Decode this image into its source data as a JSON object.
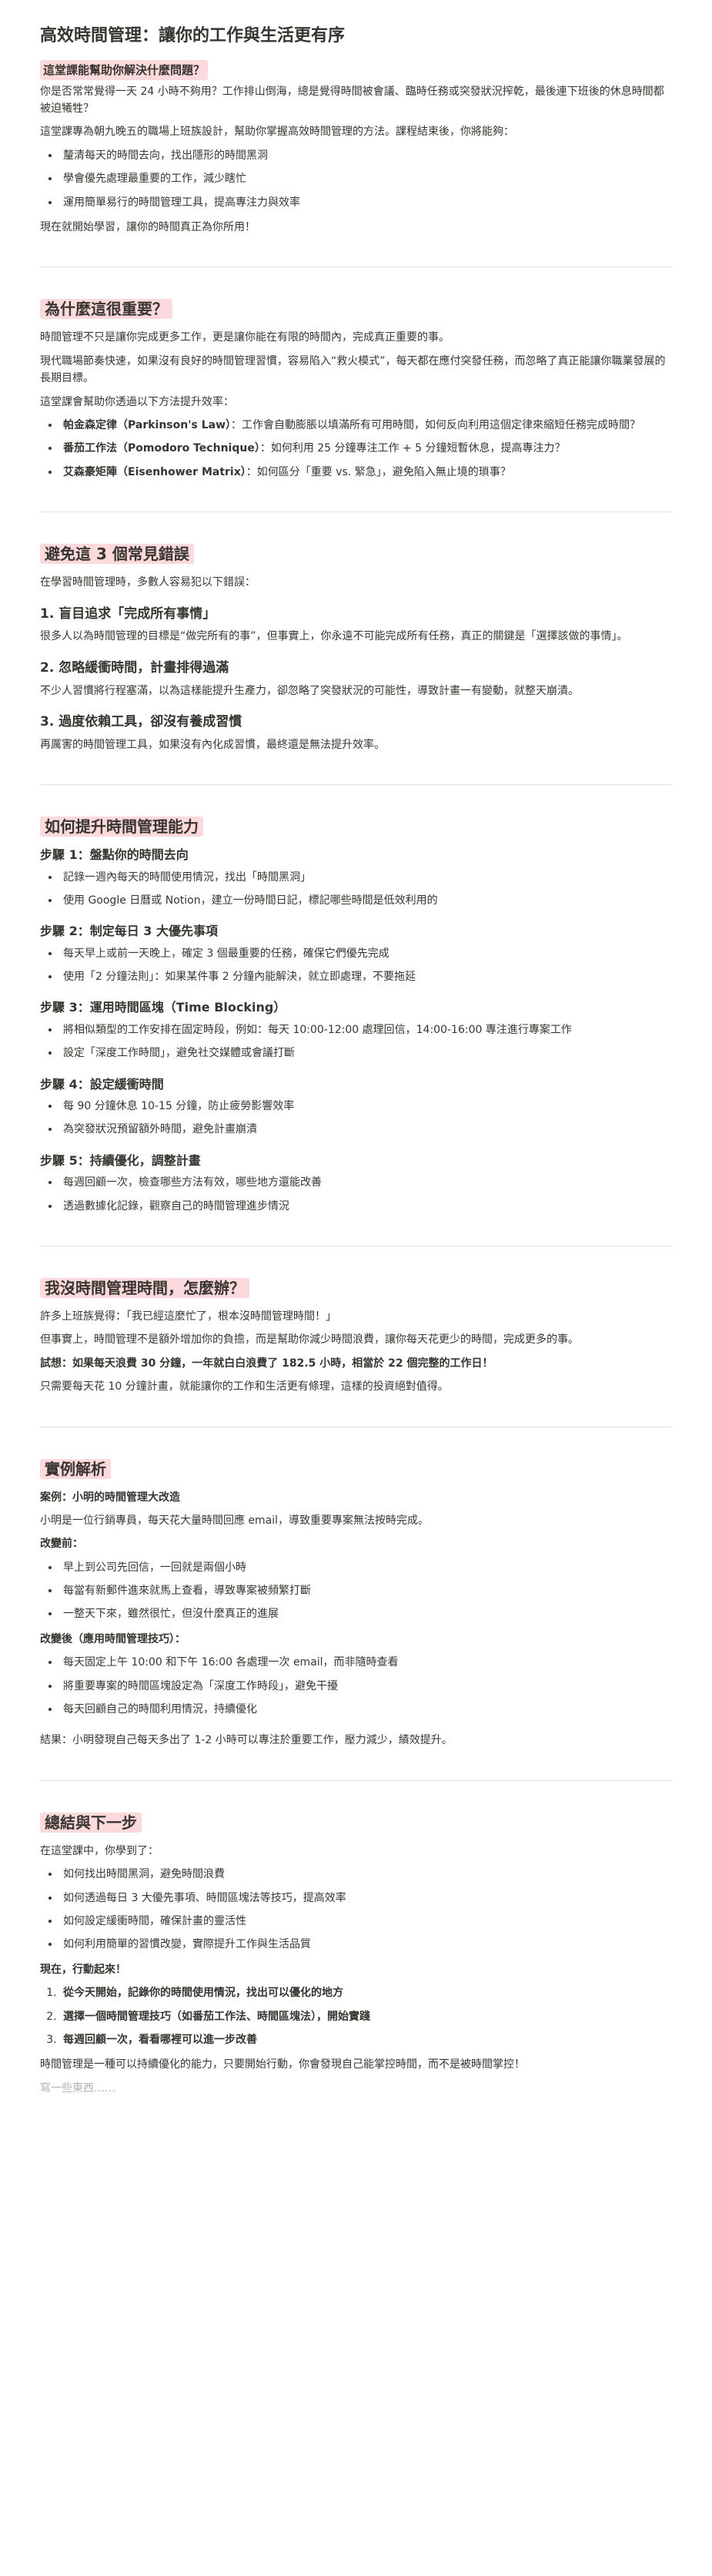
{
  "title": "高效時間管理：讓你的工作與生活更有序",
  "s1": {
    "heading": "這堂課能幫助你解決什麼問題？",
    "p1": "你是否常常覺得一天 24 小時不夠用？工作排山倒海，總是覺得時間被會議、臨時任務或突發狀況搾乾，最後連下班後的休息時間都被迫犧牲？",
    "p2": "這堂課專為朝九晚五的職場上班族設計，幫助你掌握高效時間管理的方法。課程結束後，你將能夠：",
    "items": [
      "釐清每天的時間去向，找出隱形的時間黑洞",
      "學會優先處理最重要的工作，減少瞎忙",
      "運用簡單易行的時間管理工具，提高專注力與效率"
    ],
    "p3": "現在就開始學習，讓你的時間真正為你所用！"
  },
  "s2": {
    "heading": "為什麼這很重要？",
    "p1": "時間管理不只是讓你完成更多工作，更是讓你能在有限的時間內，完成真正重要的事。",
    "p2": "現代職場節奏快速，如果沒有良好的時間管理習慣，容易陷入“救火模式”，每天都在應付突發任務，而忽略了真正能讓你職業發展的長期目標。",
    "p3": "這堂課會幫助你透過以下方法提升效率：",
    "items": [
      {
        "b": "帕金森定律（Parkinson's Law）",
        "t": "：工作會自動膨脹以填滿所有可用時間，如何反向利用這個定律來縮短任務完成時間？"
      },
      {
        "b": "番茄工作法（Pomodoro Technique）",
        "t": "：如何利用 25 分鐘專注工作 + 5 分鐘短暫休息，提高專注力？"
      },
      {
        "b": "艾森豪矩陣（Eisenhower Matrix）",
        "t": "：如何區分「重要 vs. 緊急」，避免陷入無止境的瑣事？"
      }
    ]
  },
  "s3": {
    "heading": "避免這 3 個常見錯誤",
    "p1": "在學習時間管理時，多數人容易犯以下錯誤：",
    "e1": {
      "h": "1. 盲目追求「完成所有事情」",
      "t": "很多人以為時間管理的目標是“做完所有的事”，但事實上，你永遠不可能完成所有任務，真正的關鍵是「選擇該做的事情」。"
    },
    "e2": {
      "h": "2. 忽略緩衝時間，計畫排得過滿",
      "t": "不少人習慣將行程塞滿，以為這樣能提升生產力，卻忽略了突發狀況的可能性，導致計畫一有變動，就整天崩潰。"
    },
    "e3": {
      "h": "3. 過度依賴工具，卻沒有養成習慣",
      "t": "再厲害的時間管理工具，如果沒有內化成習慣，最終還是無法提升效率。"
    }
  },
  "s4": {
    "heading": "如何提升時間管理能力",
    "steps": [
      {
        "h": "步驟 1：盤點你的時間去向",
        "items": [
          "記錄一週內每天的時間使用情況，找出「時間黑洞」",
          "使用 Google 日曆或 Notion，建立一份時間日記，標記哪些時間是低效利用的"
        ]
      },
      {
        "h": "步驟 2：制定每日 3 大優先事項",
        "items": [
          "每天早上或前一天晚上，確定 3 個最重要的任務，確保它們優先完成",
          "使用「2 分鐘法則」：如果某件事 2 分鐘內能解決，就立即處理，不要拖延"
        ]
      },
      {
        "h": "步驟 3：運用時間區塊（Time Blocking）",
        "items": [
          "將相似類型的工作安排在固定時段，例如：每天 10:00-12:00 處理回信，14:00-16:00 專注進行專案工作",
          "設定「深度工作時間」，避免社交媒體或會議打斷"
        ]
      },
      {
        "h": "步驟 4：設定緩衝時間",
        "items": [
          "每 90 分鐘休息 10-15 分鐘，防止疲勞影響效率",
          "為突發狀況預留額外時間，避免計畫崩潰"
        ]
      },
      {
        "h": "步驟 5：持續優化，調整計畫",
        "items": [
          "每週回顧一次，檢查哪些方法有效，哪些地方還能改善",
          "透過數據化記錄，觀察自己的時間管理進步情況"
        ]
      }
    ]
  },
  "s5": {
    "heading": "我沒時間管理時間，怎麼辦？",
    "p1": "許多上班族覺得：「我已經這麼忙了，根本沒時間管理時間！」",
    "p2": "但事實上，時間管理不是額外增加你的負擔，而是幫助你減少時間浪費，讓你每天花更少的時間，完成更多的事。",
    "p3": "試想：如果每天浪費 30 分鐘，一年就白白浪費了 182.5 小時，相當於 22 個完整的工作日！",
    "p4": "只需要每天花 10 分鐘計畫，就能讓你的工作和生活更有條理，這樣的投資絕對值得。"
  },
  "s6": {
    "heading": "實例解析",
    "case_title": "案例：小明的時間管理大改造",
    "p1": "小明是一位行銷專員，每天花大量時間回應 email，導致重要專案無法按時完成。",
    "before_label": "改變前：",
    "before": [
      "早上到公司先回信，一回就是兩個小時",
      "每當有新郵件進來就馬上查看，導致專案被頻繁打斷",
      "一整天下來，雖然很忙，但沒什麼真正的進展"
    ],
    "after_label": "改變後（應用時間管理技巧）：",
    "after": [
      "每天固定上午 10:00 和下午 16:00 各處理一次 email，而非隨時查看",
      "將重要專案的時間區塊設定為「深度工作時段」，避免干擾",
      "每天回顧自己的時間利用情況，持續優化"
    ],
    "result": "結果：小明發現自己每天多出了 1-2 小時可以專注於重要工作，壓力減少，績效提升。"
  },
  "s7": {
    "heading": "總結與下一步",
    "p1": "在這堂課中，你學到了：",
    "items": [
      "如何找出時間黑洞，避免時間浪費",
      "如何透過每日 3 大優先事項、時間區塊法等技巧，提高效率",
      "如何設定緩衝時間，確保計畫的靈活性",
      "如何利用簡單的習慣改變，實際提升工作與生活品質"
    ],
    "action": "現在，行動起來！",
    "steps": [
      {
        "b": "從今天開始，記錄你的時間使用情況，找出可以優化的地方"
      },
      {
        "b": "選擇一個時間管理技巧（如番茄工作法、時間區塊法），開始實踐"
      },
      {
        "b": "每週回顧一次，看看哪裡可以進一步改善"
      }
    ],
    "closing": "時間管理是一種可以持續優化的能力，只要開始行動，你會發現自己能掌控時間，而不是被時間掌控！",
    "placeholder": "寫一些東西……"
  }
}
